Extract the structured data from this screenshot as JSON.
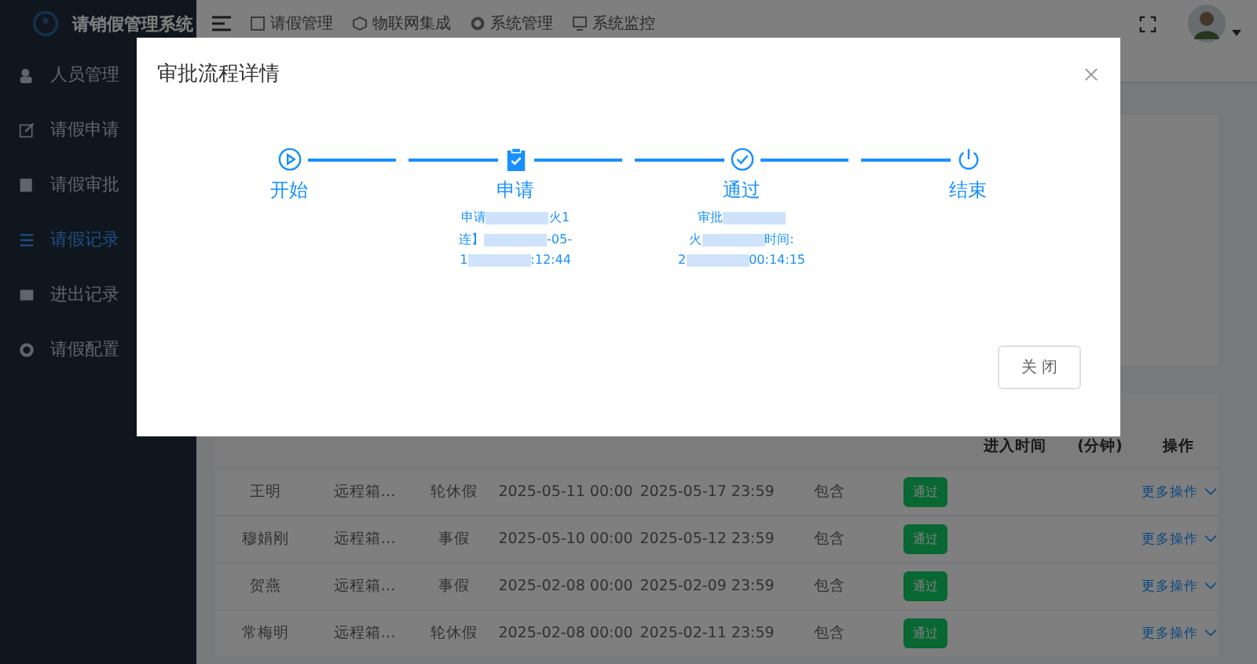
{
  "app": {
    "title": "请销假管理系统"
  },
  "top_nav": [
    {
      "label": "请假管理",
      "kind": "doc"
    },
    {
      "label": "物联网集成",
      "kind": "iot"
    },
    {
      "label": "系统管理",
      "kind": "gear"
    },
    {
      "label": "系统监控",
      "kind": "monitor"
    }
  ],
  "sidebar": {
    "items": [
      {
        "label": "人员管理",
        "kind": "user",
        "selected": false
      },
      {
        "label": "请假申请",
        "kind": "edit",
        "selected": false
      },
      {
        "label": "请假审批",
        "kind": "doc",
        "selected": false
      },
      {
        "label": "请假记录",
        "kind": "list",
        "selected": true
      },
      {
        "label": "进出记录",
        "kind": "card",
        "selected": false
      },
      {
        "label": "请假配置",
        "kind": "gear",
        "selected": false
      }
    ]
  },
  "table": {
    "columns": [
      "进入时间",
      "(分钟)",
      "操作"
    ],
    "rows": [
      {
        "name": "王明",
        "place": "远程箱…",
        "type": "轮休假",
        "start": "2025-05-11 00:00",
        "end": "2025-05-17 23:59",
        "include": "包含",
        "status": {
          "label": "通过",
          "kind": "approved"
        },
        "action": "更多操作"
      },
      {
        "name": "穆娟刚",
        "place": "远程箱…",
        "type": "事假",
        "start": "2025-05-10 00:00",
        "end": "2025-05-12 23:59",
        "include": "包含",
        "status": {
          "label": "通过",
          "kind": "approved"
        },
        "action": "更多操作"
      },
      {
        "name": "贺燕",
        "place": "远程箱…",
        "type": "事假",
        "start": "2025-02-08 00:00",
        "end": "2025-02-09 23:59",
        "include": "包含",
        "status": {
          "label": "通过",
          "kind": "approved"
        },
        "action": "更多操作"
      },
      {
        "name": "常梅明",
        "place": "远程箱…",
        "type": "轮休假",
        "start": "2025-02-08 00:00",
        "end": "2025-02-11 23:59",
        "include": "包含",
        "status": {
          "label": "通过",
          "kind": "approved"
        },
        "action": "更多操作"
      }
    ]
  },
  "dialog": {
    "title": "审批流程详情",
    "steps": [
      {
        "label": "开始",
        "kind": "start"
      },
      {
        "label": "申请",
        "kind": "apply",
        "lines": [
          [
            {
              "kind": "text",
              "text": "申请"
            },
            {
              "kind": "blur"
            },
            {
              "kind": "text",
              "text": "火1"
            }
          ],
          [
            {
              "kind": "text",
              "text": "连】"
            },
            {
              "kind": "blur"
            },
            {
              "kind": "text",
              "text": "-05-"
            }
          ],
          [
            {
              "kind": "text",
              "text": "1"
            },
            {
              "kind": "blur"
            },
            {
              "kind": "text",
              "text": ":12:44"
            }
          ]
        ]
      },
      {
        "label": "通过",
        "kind": "pass",
        "lines": [
          [
            {
              "kind": "text",
              "text": "审批"
            },
            {
              "kind": "blur"
            }
          ],
          [
            {
              "kind": "text",
              "text": "火"
            },
            {
              "kind": "blur"
            },
            {
              "kind": "text",
              "text": "时间:"
            }
          ],
          [
            {
              "kind": "text",
              "text": "2"
            },
            {
              "kind": "blur"
            },
            {
              "kind": "text",
              "text": "00:14:15"
            }
          ]
        ]
      },
      {
        "label": "结束",
        "kind": "end"
      }
    ],
    "close_button": "关 闭"
  }
}
